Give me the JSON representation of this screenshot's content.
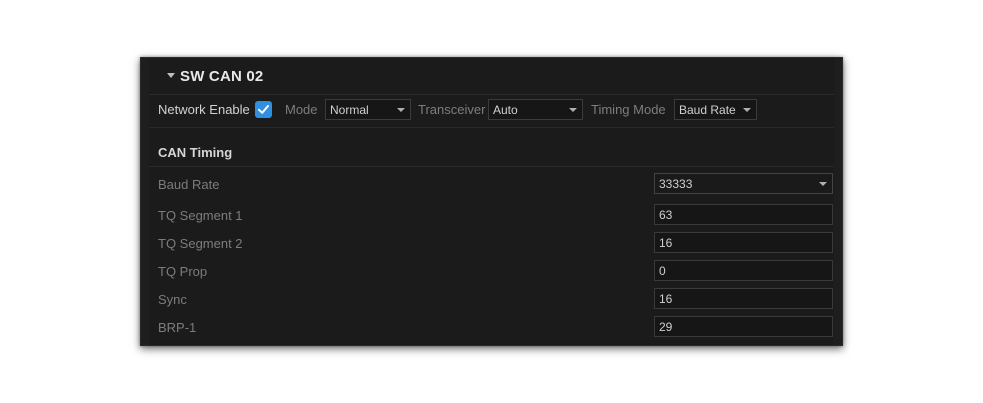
{
  "header": {
    "title": "SW CAN 02"
  },
  "network": {
    "enable_label": "Network Enable",
    "enabled": true,
    "mode_label": "Mode",
    "mode_value": "Normal",
    "transceiver_label": "Transceiver",
    "transceiver_value": "Auto",
    "timing_mode_label": "Timing Mode",
    "timing_mode_value": "Baud Rate"
  },
  "can_timing": {
    "title": "CAN Timing",
    "baud_rate": {
      "label": "Baud Rate",
      "value": "33333"
    },
    "tq_seg1": {
      "label": "TQ Segment 1",
      "value": "63"
    },
    "tq_seg2": {
      "label": "TQ Segment 2",
      "value": "16"
    },
    "tq_prop": {
      "label": "TQ Prop",
      "value": "0"
    },
    "sync": {
      "label": "Sync",
      "value": "16"
    },
    "brp": {
      "label": "BRP-1",
      "value": "29"
    }
  },
  "colors": {
    "accent": "#2f8fe0",
    "panel_bg": "#1b1b1b",
    "field_bg": "#161616"
  }
}
